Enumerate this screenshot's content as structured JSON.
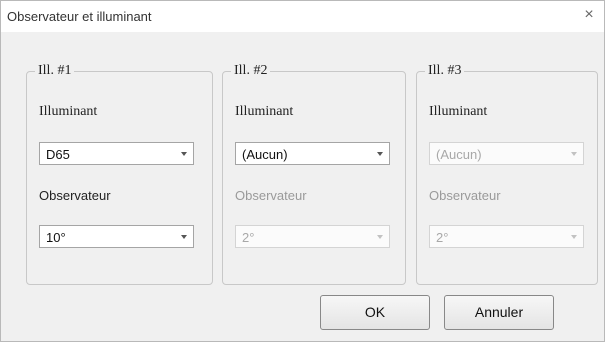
{
  "window": {
    "title": "Observateur et illuminant",
    "close_glyph": "×"
  },
  "groups": [
    {
      "legend": "Ill. #1",
      "illuminant_label": "Illuminant",
      "illuminant_value": "D65",
      "observer_label": "Observateur",
      "observer_value": "10°",
      "illuminant_enabled": true,
      "observer_enabled": true
    },
    {
      "legend": "Ill. #2",
      "illuminant_label": "Illuminant",
      "illuminant_value": "(Aucun)",
      "observer_label": "Observateur",
      "observer_value": "2°",
      "illuminant_enabled": true,
      "observer_enabled": false
    },
    {
      "legend": "Ill. #3",
      "illuminant_label": "Illuminant",
      "illuminant_value": "(Aucun)",
      "observer_label": "Observateur",
      "observer_value": "2°",
      "illuminant_enabled": false,
      "observer_enabled": false
    }
  ],
  "buttons": {
    "ok": "OK",
    "cancel": "Annuler"
  }
}
